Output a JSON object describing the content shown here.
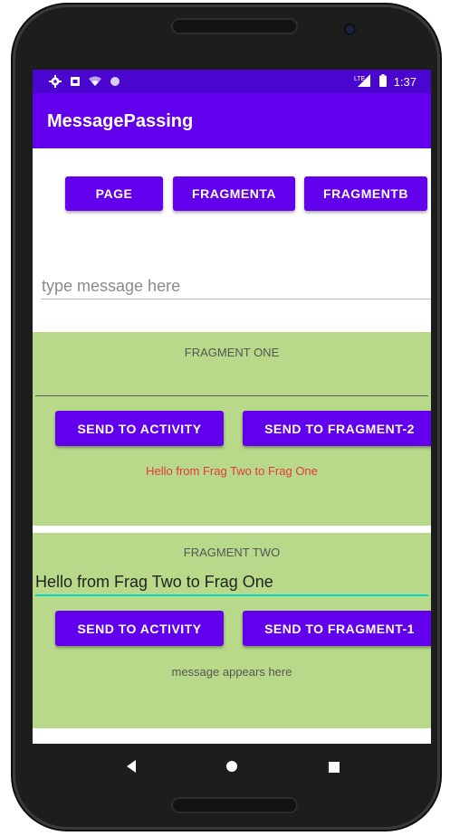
{
  "status_bar": {
    "left_icons": [
      "gear-icon",
      "sim-icon",
      "wifi-icon",
      "circle-icon"
    ],
    "signal_label": "LTE",
    "time": "1:37"
  },
  "app_bar": {
    "title": "MessagePassing"
  },
  "top_buttons": {
    "page": "PAGE",
    "fragment_a": "FRAGMENTA",
    "fragment_b": "FRAGMENTB"
  },
  "main_input": {
    "placeholder": "type message here",
    "value": ""
  },
  "fragment_one": {
    "title": "FRAGMENT ONE",
    "input_value": "",
    "send_activity": "SEND TO ACTIVITY",
    "send_fragment": "SEND TO FRAGMENT-2",
    "message": "Hello from Frag Two to Frag One",
    "message_color": "#e53935"
  },
  "fragment_two": {
    "title": "FRAGMENT TWO",
    "input_value": "Hello from Frag Two to Frag One",
    "send_activity": "SEND TO ACTIVITY",
    "send_fragment": "SEND TO FRAGMENT-1",
    "message": "message appears here",
    "message_color": "#555555"
  },
  "nav_bar": {
    "icons": [
      "back-icon",
      "home-icon",
      "recents-icon"
    ]
  },
  "colors": {
    "primary": "#6200ee",
    "primary_dark": "#4a05cf",
    "fragment_bg": "#b8d98a",
    "accent": "#03dac5"
  }
}
